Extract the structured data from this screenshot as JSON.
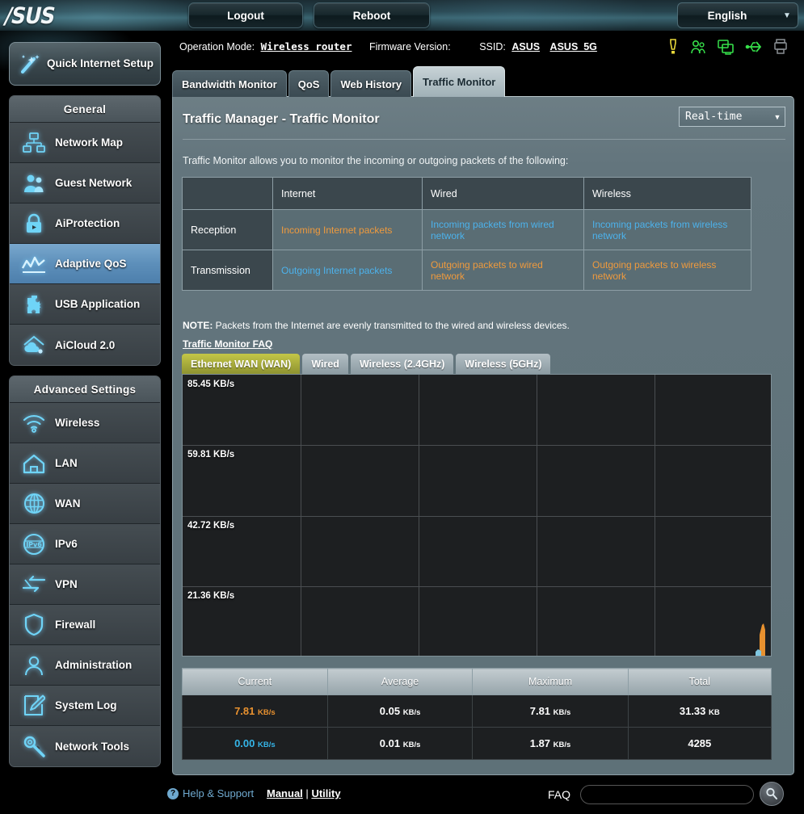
{
  "topbar": {
    "logo": "/SUS",
    "logout_label": "Logout",
    "reboot_label": "Reboot",
    "language": "English"
  },
  "statusbar": {
    "operation_mode_label": "Operation Mode:",
    "operation_mode_value": "Wireless router",
    "firmware_label": "Firmware Version:",
    "firmware_value": "",
    "ssid_label": "SSID:",
    "ssid_1": "ASUS",
    "ssid_2": "ASUS_5G",
    "icons": [
      "alert-icon",
      "guest-network-icon",
      "clients-icon",
      "usb-icon",
      "printer-icon"
    ]
  },
  "sidebar": {
    "quick_setup": "Quick Internet Setup",
    "general_title": "General",
    "general_items": [
      {
        "label": "Network Map",
        "icon": "network-map-icon"
      },
      {
        "label": "Guest Network",
        "icon": "guest-network-icon"
      },
      {
        "label": "AiProtection",
        "icon": "lock-icon"
      },
      {
        "label": "Adaptive QoS",
        "icon": "qos-chart-icon"
      },
      {
        "label": "USB Application",
        "icon": "puzzle-icon"
      },
      {
        "label": "AiCloud 2.0",
        "icon": "cloud-icon"
      }
    ],
    "advanced_title": "Advanced Settings",
    "advanced_items": [
      {
        "label": "Wireless",
        "icon": "wifi-icon"
      },
      {
        "label": "LAN",
        "icon": "home-icon"
      },
      {
        "label": "WAN",
        "icon": "globe-icon"
      },
      {
        "label": "IPv6",
        "icon": "ipv6-globe-icon"
      },
      {
        "label": "VPN",
        "icon": "vpn-arrows-icon"
      },
      {
        "label": "Firewall",
        "icon": "shield-icon"
      },
      {
        "label": "Administration",
        "icon": "user-icon"
      },
      {
        "label": "System Log",
        "icon": "pencil-note-icon"
      },
      {
        "label": "Network Tools",
        "icon": "wrench-icon"
      }
    ],
    "active_item": "Adaptive QoS"
  },
  "tabs": [
    {
      "label": "Bandwidth Monitor",
      "active": false
    },
    {
      "label": "QoS",
      "active": false
    },
    {
      "label": "Web History",
      "active": false
    },
    {
      "label": "Traffic Monitor",
      "active": true
    }
  ],
  "panel": {
    "title": "Traffic Manager - Traffic Monitor",
    "mode_value": "Real-time",
    "description": "Traffic Monitor allows you to monitor the incoming or outgoing packets of the following:",
    "note_prefix": "NOTE:",
    "note_text": " Packets from the Internet are evenly transmitted to the wired and wireless devices.",
    "faq_link": "Traffic Monitor FAQ"
  },
  "traffic_table": {
    "headers": [
      "",
      "Internet",
      "Wired",
      "Wireless"
    ],
    "rows": [
      {
        "label": "Reception",
        "cells": [
          {
            "text": "Incoming Internet packets",
            "color": "orange"
          },
          {
            "text": "Incoming packets from wired network",
            "color": "blue"
          },
          {
            "text": "Incoming packets from wireless network",
            "color": "blue"
          }
        ]
      },
      {
        "label": "Transmission",
        "cells": [
          {
            "text": "Outgoing Internet packets",
            "color": "blue"
          },
          {
            "text": "Outgoing packets to wired network",
            "color": "orange"
          },
          {
            "text": "Outgoing packets to wireless network",
            "color": "orange"
          }
        ]
      }
    ]
  },
  "interface_tabs": [
    {
      "label": "Ethernet WAN (WAN)",
      "active": true
    },
    {
      "label": "Wired",
      "active": false
    },
    {
      "label": "Wireless (2.4GHz)",
      "active": false
    },
    {
      "label": "Wireless (5GHz)",
      "active": false
    }
  ],
  "chart_data": {
    "type": "area",
    "title": "Ethernet WAN (WAN) Real-time Traffic",
    "xlabel": "",
    "ylabel": "KB/s",
    "ylim": [
      0,
      106.8
    ],
    "yticks": [
      85.45,
      59.81,
      42.72,
      21.36
    ],
    "ytick_labels": [
      "85.45 KB/s",
      "59.81 KB/s",
      "42.72 KB/s",
      "21.36 KB/s"
    ],
    "grid": true,
    "grid_columns": 5,
    "grid_rows": 4,
    "legend": [
      "Reception",
      "Transmission"
    ],
    "legend_position": "none",
    "series": [
      {
        "name": "Reception",
        "color": "#e8912f",
        "note": "single spike at right edge of time axis",
        "points": [
          {
            "x": 0.975,
            "y": 0
          },
          {
            "x": 0.982,
            "y": 7.81
          },
          {
            "x": 0.99,
            "y": 3.2
          },
          {
            "x": 0.996,
            "y": 7.81
          },
          {
            "x": 1.0,
            "y": 0
          }
        ]
      },
      {
        "name": "Transmission",
        "color": "#5ab7e0",
        "note": "near zero baseline, small bump at right edge",
        "points": [
          {
            "x": 0.975,
            "y": 0
          },
          {
            "x": 0.985,
            "y": 1.2
          },
          {
            "x": 1.0,
            "y": 0
          }
        ]
      }
    ]
  },
  "stats_table": {
    "headers": [
      "Current",
      "Average",
      "Maximum",
      "Total"
    ],
    "rows": [
      {
        "series": "Reception",
        "color": "#e8912f",
        "current_value": "7.81",
        "current_unit": "KB/s",
        "average_value": "0.05",
        "average_unit": "KB/s",
        "maximum_value": "7.81",
        "maximum_unit": "KB/s",
        "total_value": "31.33",
        "total_unit": "KB"
      },
      {
        "series": "Transmission",
        "color": "#35b5e8",
        "current_value": "0.00",
        "current_unit": "KB/s",
        "average_value": "0.01",
        "average_unit": "KB/s",
        "maximum_value": "1.87",
        "maximum_unit": "KB/s",
        "total_value": "4285",
        "total_unit": ""
      }
    ]
  },
  "footer": {
    "help_label": "Help & Support",
    "manual_label": "Manual",
    "separator": "|",
    "utility_label": "Utility",
    "faq_label": "FAQ",
    "faq_placeholder": "",
    "faq_value": ""
  },
  "colors": {
    "accent_orange": "#e8912f",
    "accent_blue": "#4cb2ec",
    "active_menu": "#5d8fba",
    "active_iftab": "#a9ad3c"
  }
}
